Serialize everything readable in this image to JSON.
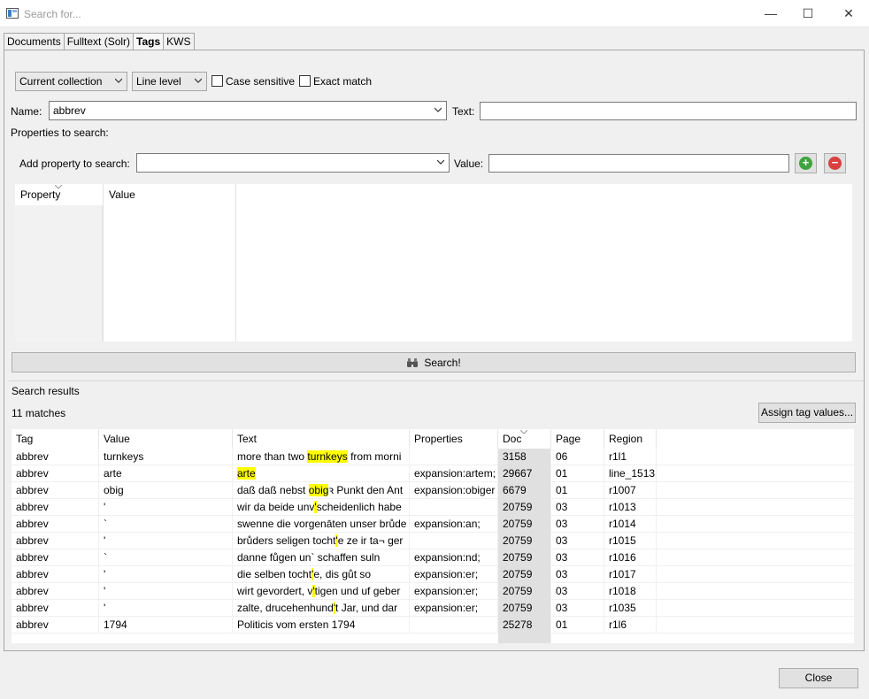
{
  "window": {
    "title": "Search for...",
    "minimize_glyph": "—",
    "maximize_glyph": "☐",
    "close_glyph": "✕"
  },
  "tabs": [
    {
      "label": "Documents"
    },
    {
      "label": "Fulltext (Solr)"
    },
    {
      "label": "Tags",
      "active": true
    },
    {
      "label": "KWS"
    }
  ],
  "filters": {
    "scope": "Current collection",
    "level": "Line level",
    "case_sensitive_label": "Case sensitive",
    "case_sensitive": false,
    "exact_match_label": "Exact match",
    "exact_match": false
  },
  "name_field": {
    "label": "Name:",
    "value": "abbrev"
  },
  "text_field": {
    "label": "Text:",
    "value": ""
  },
  "properties": {
    "heading": "Properties to search:",
    "add_label": "Add property to search:",
    "add_value": "",
    "value_label": "Value:",
    "value": "",
    "columns": [
      "Property",
      "Value"
    ]
  },
  "search_button": {
    "label": "Search!",
    "icon": "binoculars-icon"
  },
  "results": {
    "heading": "Search results",
    "count": "11 matches",
    "assign_label": "Assign tag values...",
    "columns": [
      "Tag",
      "Value",
      "Text",
      "Properties",
      "Doc",
      "Page",
      "Region"
    ],
    "rows": [
      {
        "tag": "abbrev",
        "value": "turnkeys",
        "text_pre": "more than two ",
        "text_match": "turnkeys",
        "text_post": " from morni",
        "properties": "",
        "doc": "3158",
        "page": "06",
        "region": "r1l1"
      },
      {
        "tag": "abbrev",
        "value": "arte",
        "text_pre": "",
        "text_match": "arte",
        "text_post": "",
        "properties": "expansion:artem;",
        "doc": "29667",
        "page": "01",
        "region": "line_1513"
      },
      {
        "tag": "abbrev",
        "value": "obig",
        "text_pre": " daß daß nebst ",
        "text_match": "obig",
        "text_post": "ꝛ Punkt den Ant",
        "properties": "expansion:obiger",
        "doc": "6679",
        "page": "01",
        "region": "r1007"
      },
      {
        "tag": "abbrev",
        "value": "'",
        "text_pre": " wir da beide unv",
        "text_match": "'",
        "text_post": "scheidenlich habe",
        "properties": "",
        "doc": "20759",
        "page": "03",
        "region": "r1013"
      },
      {
        "tag": "abbrev",
        "value": "`",
        "text_pre": " swenne die vorgenāten unser brůde",
        "text_match": "",
        "text_post": "",
        "properties": "expansion:an;",
        "doc": "20759",
        "page": "03",
        "region": "r1014"
      },
      {
        "tag": "abbrev",
        "value": "'",
        "text_pre": " brůders seligen tocht",
        "text_match": "'",
        "text_post": "e ze ir ta¬ ger",
        "properties": "",
        "doc": "20759",
        "page": "03",
        "region": "r1015"
      },
      {
        "tag": "abbrev",
        "value": "`",
        "text_pre": " danne fůgen un` schaffen suln",
        "text_match": "",
        "text_post": "",
        "properties": "expansion:nd;",
        "doc": "20759",
        "page": "03",
        "region": "r1016"
      },
      {
        "tag": "abbrev",
        "value": "'",
        "text_pre": " die selben tocht",
        "text_match": "'",
        "text_post": "e, dis gůt so",
        "properties": "expansion:er;",
        "doc": "20759",
        "page": "03",
        "region": "r1017"
      },
      {
        "tag": "abbrev",
        "value": "'",
        "text_pre": " wirt gevordert, v",
        "text_match": "'",
        "text_post": "tigen und uf geber",
        "properties": "expansion:er;",
        "doc": "20759",
        "page": "03",
        "region": "r1018"
      },
      {
        "tag": "abbrev",
        "value": "'",
        "text_pre": " zalte, drucehenhund",
        "text_match": "'",
        "text_post": "t Jar, und dar",
        "properties": "expansion:er;",
        "doc": "20759",
        "page": "03",
        "region": "r1035"
      },
      {
        "tag": "abbrev",
        "value": "1794",
        "text_pre": " Politicis vom ersten 1794",
        "text_match": "",
        "text_post": "",
        "properties": "",
        "doc": "25278",
        "page": "01",
        "region": "r1l6"
      }
    ]
  },
  "close_button": {
    "label": "Close"
  },
  "colors": {
    "highlight": "#ffff00",
    "add_green": "#3fa33f",
    "remove_red": "#d94040"
  }
}
